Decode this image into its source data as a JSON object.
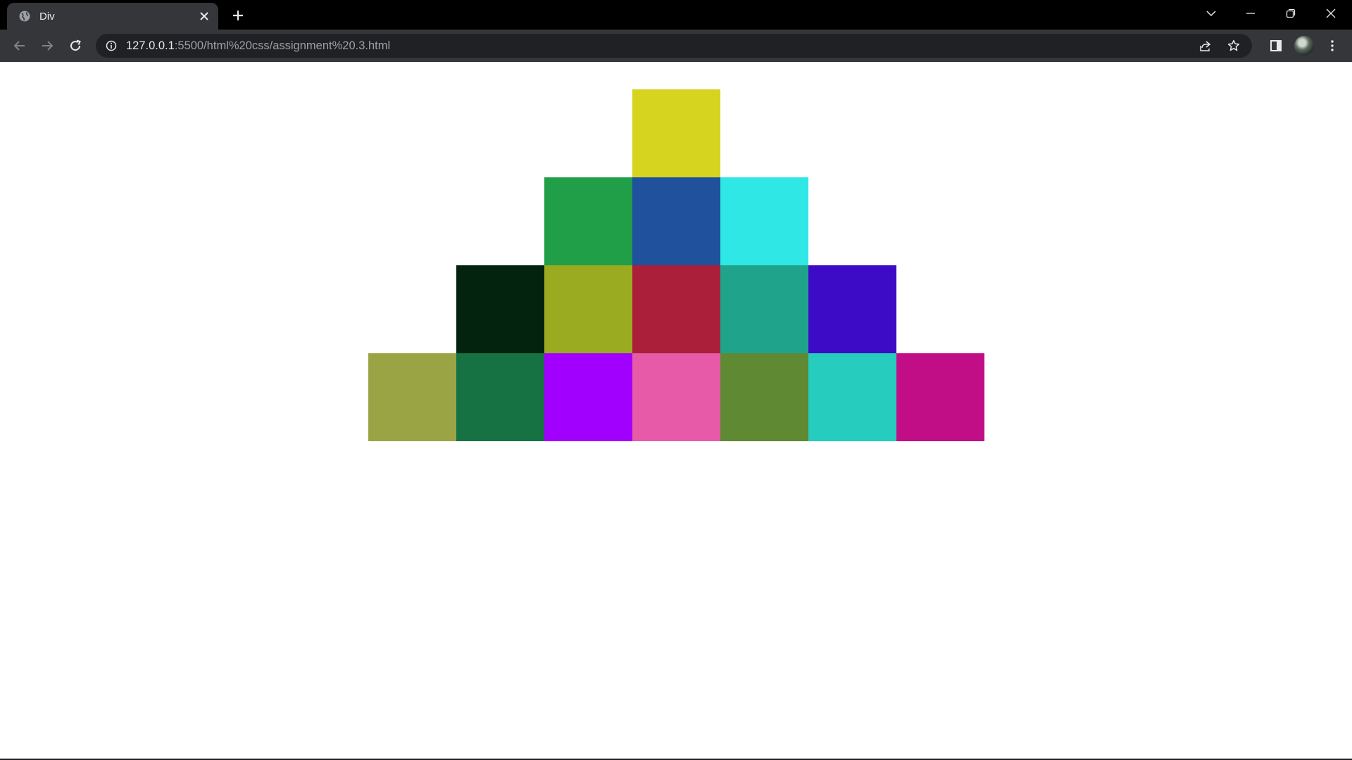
{
  "browser": {
    "tab": {
      "title": "Div"
    },
    "address": {
      "host": "127.0.0.1",
      "rest": ":5500/html%20css/assignment%20.3.html"
    },
    "icons": {
      "favicon": "globe-icon",
      "close": "close-icon",
      "new_tab": "plus-icon",
      "back": "back-arrow-icon",
      "forward": "forward-arrow-icon",
      "reload": "reload-icon",
      "info": "info-icon",
      "share": "share-icon",
      "bookmark": "star-icon",
      "side_panel": "side-panel-icon",
      "menu": "kebab-menu-icon",
      "tab_search": "chevron-down-icon",
      "minimize": "minimize-icon",
      "restore": "restore-icon",
      "window_close": "window-close-icon"
    }
  },
  "pyramid": {
    "rows": [
      [
        "#d6d41f"
      ],
      [
        "#209e48",
        "#1f519c",
        "#2fe7e5"
      ],
      [
        "#03230e",
        "#9aab21",
        "#ab1f3a",
        "#1fa48b",
        "#3d0ac5"
      ],
      [
        "#9ba444",
        "#167243",
        "#a200fe",
        "#e65aa8",
        "#5f8932",
        "#26cdbe",
        "#c10e87"
      ]
    ]
  }
}
